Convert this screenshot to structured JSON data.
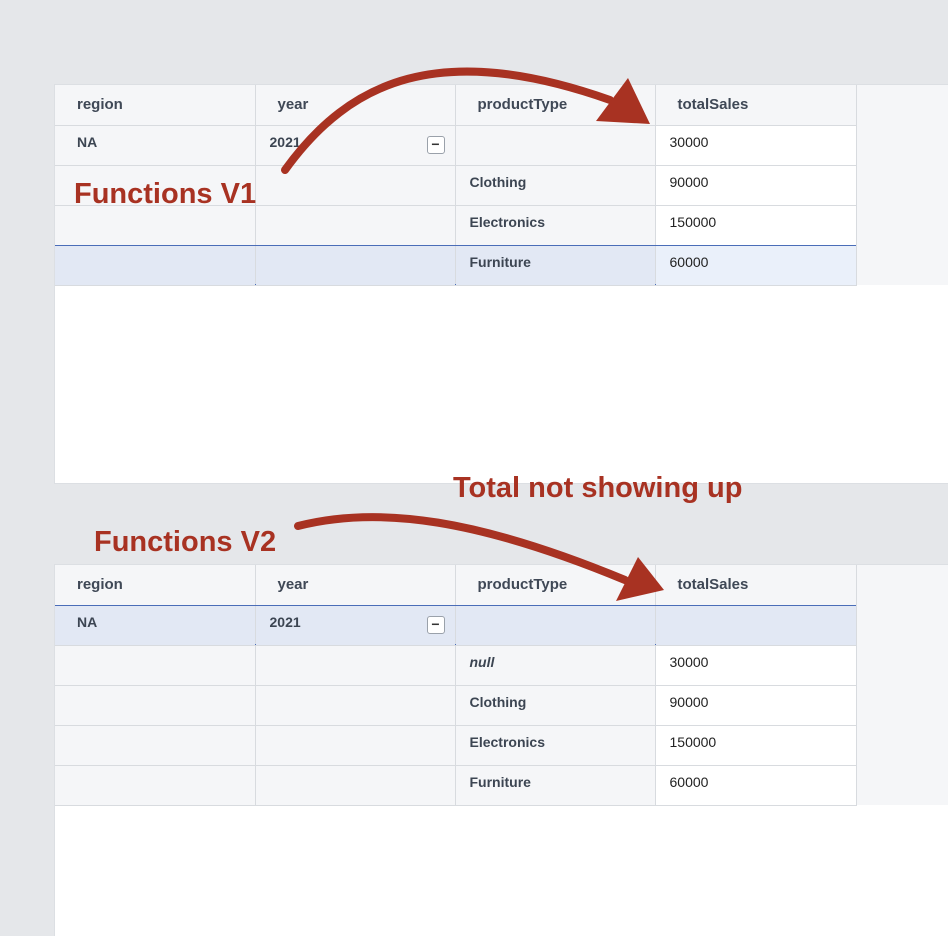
{
  "columns": [
    "region",
    "year",
    "productType",
    "totalSales"
  ],
  "table_v1": {
    "rows": [
      {
        "region": "NA",
        "year": "2021",
        "productType": "",
        "totalSales": "30000",
        "collapsible": true
      },
      {
        "region": "",
        "year": "",
        "productType": "Clothing",
        "totalSales": "90000"
      },
      {
        "region": "",
        "year": "",
        "productType": "Electronics",
        "totalSales": "150000"
      },
      {
        "region": "",
        "year": "",
        "productType": "Furniture",
        "totalSales": "60000",
        "selected": true
      }
    ]
  },
  "table_v2": {
    "rows": [
      {
        "region": "NA",
        "year": "2021",
        "productType": "",
        "totalSales": "",
        "collapsible": true,
        "selected": true
      },
      {
        "region": "",
        "year": "",
        "productType": "null",
        "totalSales": "30000"
      },
      {
        "region": "",
        "year": "",
        "productType": "Clothing",
        "totalSales": "90000"
      },
      {
        "region": "",
        "year": "",
        "productType": "Electronics",
        "totalSales": "150000"
      },
      {
        "region": "",
        "year": "",
        "productType": "Furniture",
        "totalSales": "60000"
      }
    ]
  },
  "collapse_symbol": "−",
  "annotations": {
    "functions_v1": "Functions V1",
    "functions_v2": "Functions V2",
    "total_missing": "Total not showing up"
  },
  "colors": {
    "annotation": "#a83222",
    "selection_border": "#4a6db8",
    "selection_fill": "#e2e8f4"
  }
}
